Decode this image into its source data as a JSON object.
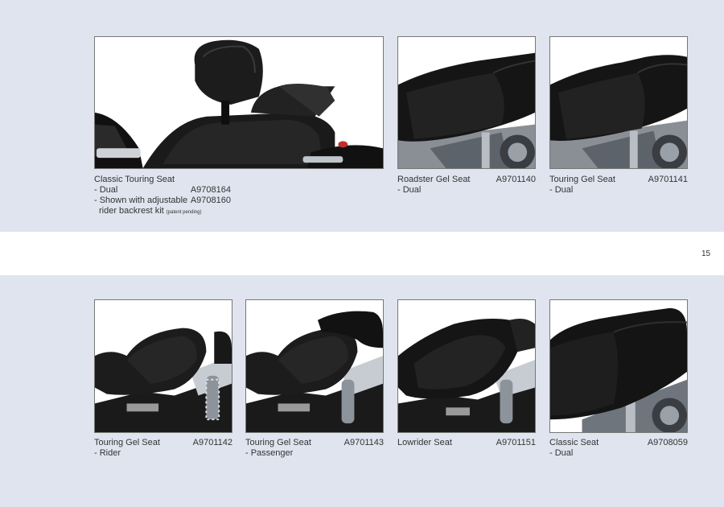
{
  "page": {
    "number": "15"
  },
  "top_products": [
    {
      "id": "classic-touring",
      "title": "Classic Touring Seat",
      "lines": [
        {
          "text": "- Dual",
          "code": "A9708164"
        },
        {
          "text": "- Shown with adjustable",
          "code": "A9708160"
        },
        {
          "text": "rider backrest kit",
          "note": "(patent pending)"
        }
      ],
      "icon": "touring-seat-with-backrest-photo"
    },
    {
      "id": "roadster-gel",
      "title": "Roadster Gel Seat",
      "code": "A9701140",
      "lines": [
        {
          "text": "- Dual"
        }
      ],
      "icon": "roadster-gel-seat-photo"
    },
    {
      "id": "touring-gel-dual",
      "title": "Touring Gel Seat",
      "code": "A9701141",
      "lines": [
        {
          "text": "- Dual"
        }
      ],
      "icon": "touring-gel-seat-dual-photo"
    }
  ],
  "bottom_products": [
    {
      "id": "touring-gel-rider",
      "title": "Touring Gel Seat",
      "code": "A9701142",
      "lines": [
        {
          "text": "- Rider"
        }
      ],
      "icon": "touring-gel-seat-rider-photo"
    },
    {
      "id": "touring-gel-passenger",
      "title": "Touring Gel Seat",
      "code": "A9701143",
      "lines": [
        {
          "text": "- Passenger"
        }
      ],
      "icon": "touring-gel-seat-passenger-photo"
    },
    {
      "id": "lowrider",
      "title": "Lowrider Seat",
      "code": "A9701151",
      "lines": [],
      "icon": "lowrider-seat-photo"
    },
    {
      "id": "classic-dual",
      "title": "Classic Seat",
      "code": "A9708059",
      "lines": [
        {
          "text": "- Dual"
        }
      ],
      "icon": "classic-seat-dual-photo"
    }
  ]
}
